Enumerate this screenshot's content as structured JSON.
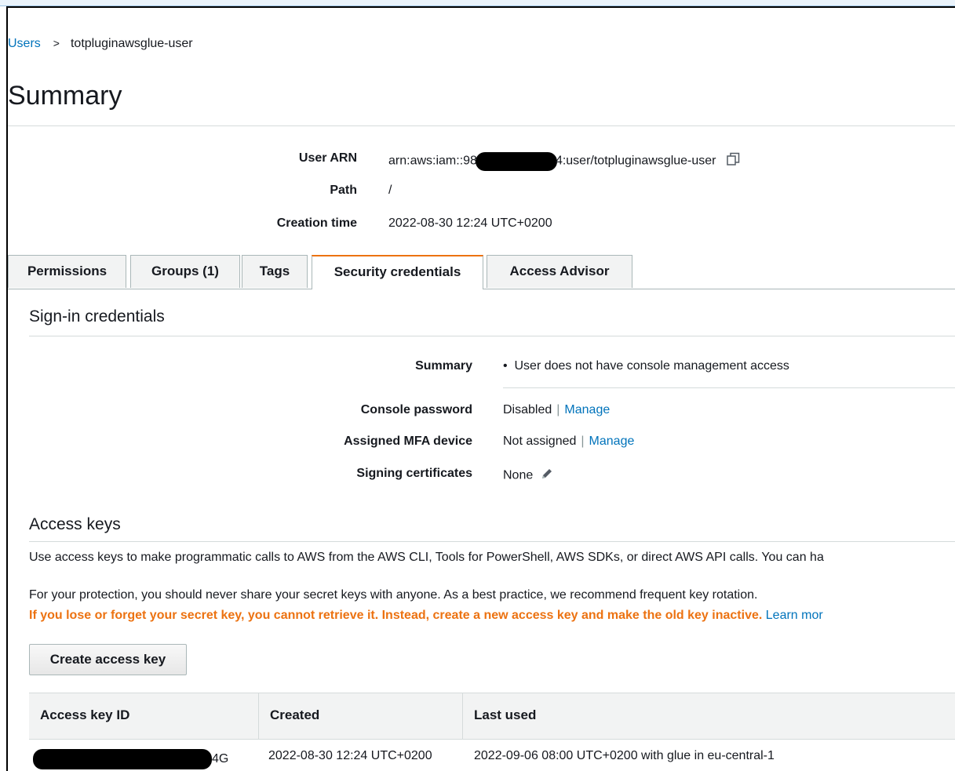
{
  "breadcrumb": {
    "parent": "Users",
    "separator": ">",
    "current": "totpluginawsglue-user"
  },
  "page_title": "Summary",
  "summary": {
    "user_arn_label": "User ARN",
    "user_arn_prefix": "arn:aws:iam::98",
    "user_arn_suffix": "4:user/totpluginawsglue-user",
    "path_label": "Path",
    "path_value": "/",
    "creation_time_label": "Creation time",
    "creation_time_value": "2022-08-30 12:24 UTC+0200"
  },
  "tabs": [
    {
      "label": "Permissions",
      "active": false
    },
    {
      "label": "Groups (1)",
      "active": false
    },
    {
      "label": "Tags",
      "active": false
    },
    {
      "label": "Security credentials",
      "active": true
    },
    {
      "label": "Access Advisor",
      "active": false
    }
  ],
  "signin": {
    "title": "Sign-in credentials",
    "summary_label": "Summary",
    "summary_value": "User does not have console management access",
    "console_password_label": "Console password",
    "console_password_value": "Disabled",
    "manage_label": "Manage",
    "mfa_label": "Assigned MFA device",
    "mfa_value": "Not assigned",
    "signing_certs_label": "Signing certificates",
    "signing_certs_value": "None"
  },
  "access_keys": {
    "title": "Access keys",
    "description": "Use access keys to make programmatic calls to AWS from the AWS CLI, Tools for PowerShell, AWS SDKs, or direct AWS API calls. You can ha",
    "protection": "For your protection, you should never share your secret keys with anyone. As a best practice, we recommend frequent key rotation.",
    "warning": "If you lose or forget your secret key, you cannot retrieve it. Instead, create a new access key and make the old key inactive.",
    "learn_more": "Learn mor",
    "create_button": "Create access key",
    "columns": [
      "Access key ID",
      "Created",
      "Last used"
    ],
    "rows": [
      {
        "key_id_suffix": "4G",
        "created": "2022-08-30 12:24 UTC+0200",
        "last_used": "2022-09-06 08:00 UTC+0200 with glue in eu-central-1"
      }
    ]
  },
  "colors": {
    "link": "#0073bb",
    "active_tab_accent": "#ec7211",
    "warning_text": "#ec7211"
  },
  "icons": {
    "copy": "copy-icon",
    "edit": "pencil-icon",
    "bullet": "bullet-icon"
  }
}
